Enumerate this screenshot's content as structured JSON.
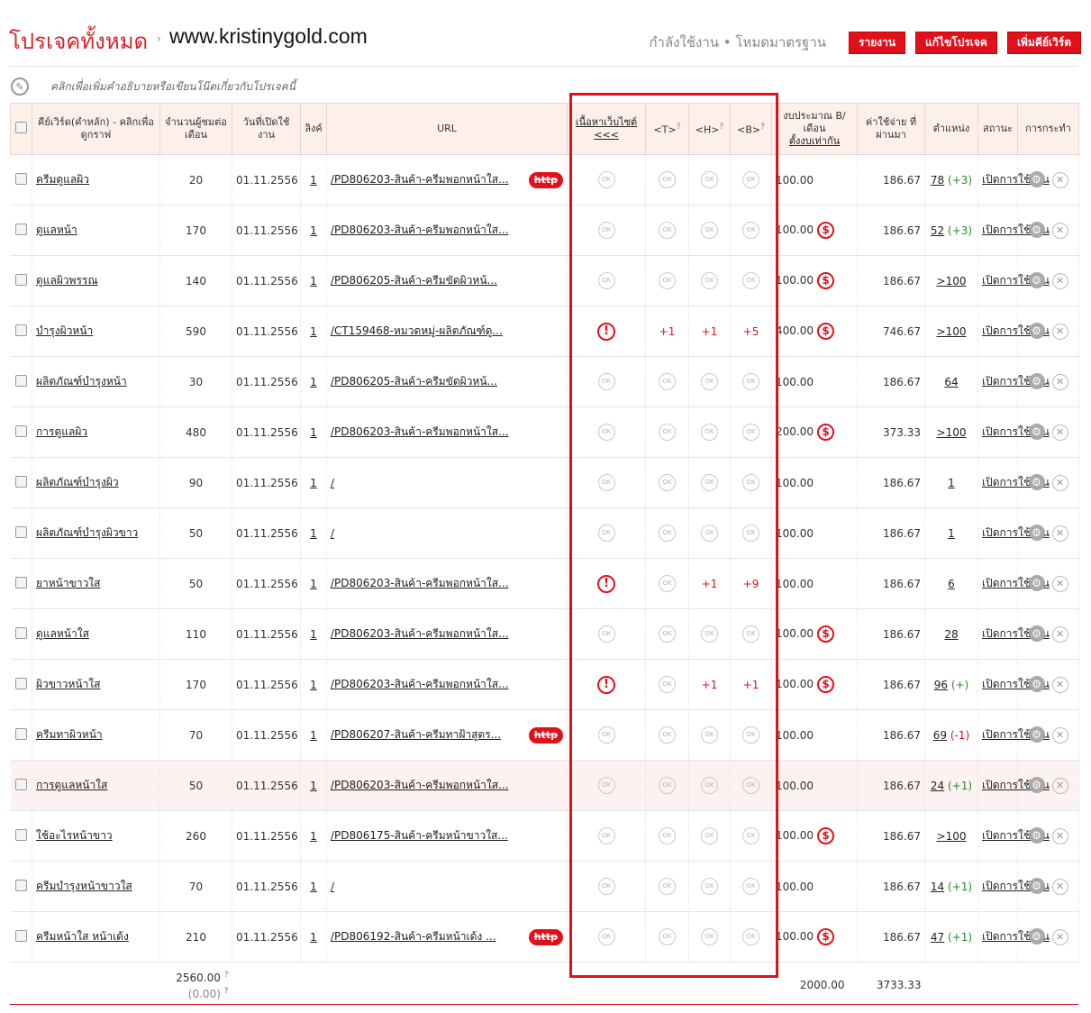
{
  "header": {
    "title": "โปรเจคทั้งหมด",
    "arrow": "›",
    "domain": "www.kristinygold.com",
    "status": "กำลังใช้งาน  •  โหมดมาตรฐาน",
    "buttons": [
      "รายงาน",
      "แก้ไขโปรเจค",
      "เพิ่มคีย์เวิร์ด"
    ]
  },
  "description_placeholder": "คลิกเพื่อเพิ่มคำอธิบายหรือเขียนโน๊ตเกี่ยวกับโปรเจคนี้",
  "columns": {
    "keyword": "คีย์เวิร์ด(คำหลัก) - คลิกเพื่อดูกราฟ",
    "searches": "จำนวนผู้ชมต่อเดือน",
    "open_date": "วันที่เปิดใช้งาน",
    "links": "ลิงค์",
    "url": "URL",
    "content": "เนื้อหาเว็บไซต์",
    "content_arrows": "<<<",
    "t": "<T>",
    "h": "<H>",
    "b": "<B>",
    "q": "?",
    "budget": "งบประมาณ B/เดือน",
    "budget_link": "ตั้งงบเท่ากัน",
    "spent": "ค่าใช้จ่าย ที่ผ่านมา",
    "position": "ตำแหน่ง",
    "status": "สถานะ",
    "actions": "การกระทำ"
  },
  "ok_label": "OK",
  "warn_label": "!",
  "http_label": "http",
  "dollar_label": "$",
  "gear_label": "⚙",
  "close_label": "✕",
  "row_status": "เปิดการใช้งาน",
  "rows": [
    {
      "keyword": "ครีมดูแลผิว",
      "searches": "20",
      "date": "01.11.2556",
      "links": "1",
      "url": "/PD806203-สินค้า-ครีมพอกหน้าใส...",
      "http": true,
      "content": "ok",
      "t": "ok",
      "h": "ok",
      "b": "ok",
      "budget": "100.00",
      "dollar": false,
      "spent": "186.67",
      "pos": "78",
      "delta": "(+3)",
      "dcls": "green"
    },
    {
      "keyword": "ดูแลหน้า",
      "searches": "170",
      "date": "01.11.2556",
      "links": "1",
      "url": "/PD806203-สินค้า-ครีมพอกหน้าใส...",
      "http": false,
      "content": "ok",
      "t": "ok",
      "h": "ok",
      "b": "ok",
      "budget": "100.00",
      "dollar": true,
      "spent": "186.67",
      "pos": "52",
      "delta": "(+3)",
      "dcls": "green"
    },
    {
      "keyword": "ดูแลผิวพรรณ",
      "searches": "140",
      "date": "01.11.2556",
      "links": "1",
      "url": "/PD806205-สินค้า-ครีมขัดผิวหน้...",
      "http": false,
      "content": "ok",
      "t": "ok",
      "h": "ok",
      "b": "ok",
      "budget": "100.00",
      "dollar": true,
      "spent": "186.67",
      "pos": ">100",
      "delta": "",
      "dcls": ""
    },
    {
      "keyword": "บำรุงผิวหน้า",
      "searches": "590",
      "date": "01.11.2556",
      "links": "1",
      "url": "/CT159468-หมวดหมู่-ผลิตภัณฑ์ดู...",
      "http": false,
      "content": "warn",
      "t": "+1",
      "h": "+1",
      "b": "+5",
      "budget": "400.00",
      "dollar": true,
      "spent": "746.67",
      "pos": ">100",
      "delta": "",
      "dcls": ""
    },
    {
      "keyword": "ผลิตภัณฑ์บำรุงหน้า",
      "searches": "30",
      "date": "01.11.2556",
      "links": "1",
      "url": "/PD806205-สินค้า-ครีมขัดผิวหน้...",
      "http": false,
      "content": "ok",
      "t": "ok",
      "h": "ok",
      "b": "ok",
      "budget": "100.00",
      "dollar": false,
      "spent": "186.67",
      "pos": "64",
      "delta": "",
      "dcls": ""
    },
    {
      "keyword": "การดูแลผิว",
      "searches": "480",
      "date": "01.11.2556",
      "links": "1",
      "url": "/PD806203-สินค้า-ครีมพอกหน้าใส...",
      "http": false,
      "content": "ok",
      "t": "ok",
      "h": "ok",
      "b": "ok",
      "budget": "200.00",
      "dollar": true,
      "spent": "373.33",
      "pos": ">100",
      "delta": "",
      "dcls": ""
    },
    {
      "keyword": "ผลิตภัณฑ์บำรุงผิว",
      "searches": "90",
      "date": "01.11.2556",
      "links": "1",
      "url": "/",
      "http": false,
      "content": "ok",
      "t": "ok",
      "h": "ok",
      "b": "ok",
      "budget": "100.00",
      "dollar": false,
      "spent": "186.67",
      "pos": "1",
      "delta": "",
      "dcls": ""
    },
    {
      "keyword": "ผลิตภัณฑ์บำรุงผิวขาว",
      "searches": "50",
      "date": "01.11.2556",
      "links": "1",
      "url": "/",
      "http": false,
      "content": "ok",
      "t": "ok",
      "h": "ok",
      "b": "ok",
      "budget": "100.00",
      "dollar": false,
      "spent": "186.67",
      "pos": "1",
      "delta": "",
      "dcls": ""
    },
    {
      "keyword": "ยาหน้าขาวใส",
      "searches": "50",
      "date": "01.11.2556",
      "links": "1",
      "url": "/PD806203-สินค้า-ครีมพอกหน้าใส...",
      "http": false,
      "content": "warn",
      "t": "ok",
      "h": "+1",
      "b": "+9",
      "budget": "100.00",
      "dollar": false,
      "spent": "186.67",
      "pos": "6",
      "delta": "",
      "dcls": ""
    },
    {
      "keyword": "ดูแลหน้าใส",
      "searches": "110",
      "date": "01.11.2556",
      "links": "1",
      "url": "/PD806203-สินค้า-ครีมพอกหน้าใส...",
      "http": false,
      "content": "ok",
      "t": "ok",
      "h": "ok",
      "b": "ok",
      "budget": "100.00",
      "dollar": true,
      "spent": "186.67",
      "pos": "28",
      "delta": "",
      "dcls": ""
    },
    {
      "keyword": "ผิวขาวหน้าใส",
      "searches": "170",
      "date": "01.11.2556",
      "links": "1",
      "url": "/PD806203-สินค้า-ครีมพอกหน้าใส...",
      "http": false,
      "content": "warn",
      "t": "ok",
      "h": "+1",
      "b": "+1",
      "budget": "100.00",
      "dollar": true,
      "spent": "186.67",
      "pos": "96",
      "delta": "(+)",
      "dcls": "green"
    },
    {
      "keyword": "ครีมทาผิวหน้า",
      "searches": "70",
      "date": "01.11.2556",
      "links": "1",
      "url": "/PD806207-สินค้า-ครีมทาฝ้าสูตร...",
      "http": true,
      "content": "ok",
      "t": "ok",
      "h": "ok",
      "b": "ok",
      "budget": "100.00",
      "dollar": false,
      "spent": "186.67",
      "pos": "69",
      "delta": "(-1)",
      "dcls": "red"
    },
    {
      "keyword": "การดูแลหน้าใส",
      "searches": "50",
      "date": "01.11.2556",
      "links": "1",
      "url": "/PD806203-สินค้า-ครีมพอกหน้าใส...",
      "http": false,
      "content": "ok",
      "t": "ok",
      "h": "ok",
      "b": "ok",
      "budget": "100.00",
      "dollar": false,
      "spent": "186.67",
      "pos": "24",
      "delta": "(+1)",
      "dcls": "green",
      "hl": true
    },
    {
      "keyword": "ใช้อะไรหน้าขาว",
      "searches": "260",
      "date": "01.11.2556",
      "links": "1",
      "url": "/PD806175-สินค้า-ครีมหน้าขาวใส...",
      "http": false,
      "content": "ok",
      "t": "ok",
      "h": "ok",
      "b": "ok",
      "budget": "100.00",
      "dollar": true,
      "spent": "186.67",
      "pos": ">100",
      "delta": "",
      "dcls": ""
    },
    {
      "keyword": "ครีมบำรุงหน้าขาวใส",
      "searches": "70",
      "date": "01.11.2556",
      "links": "1",
      "url": "/",
      "http": false,
      "content": "ok",
      "t": "ok",
      "h": "ok",
      "b": "ok",
      "budget": "100.00",
      "dollar": false,
      "spent": "186.67",
      "pos": "14",
      "delta": "(+1)",
      "dcls": "green"
    },
    {
      "keyword": "ครีมหน้าใส หน้าเด้ง",
      "searches": "210",
      "date": "01.11.2556",
      "links": "1",
      "url": "/PD806192-สินค้า-ครีมหน้าเด้ง ...",
      "http": true,
      "content": "ok",
      "t": "ok",
      "h": "ok",
      "b": "ok",
      "budget": "100.00",
      "dollar": true,
      "spent": "186.67",
      "pos": "47",
      "delta": "(+1)",
      "dcls": "green"
    }
  ],
  "footer": {
    "total_searches": "2560.00",
    "total_searches_sub": "(0.00)",
    "total_budget": "2000.00",
    "total_spent": "3733.33"
  }
}
